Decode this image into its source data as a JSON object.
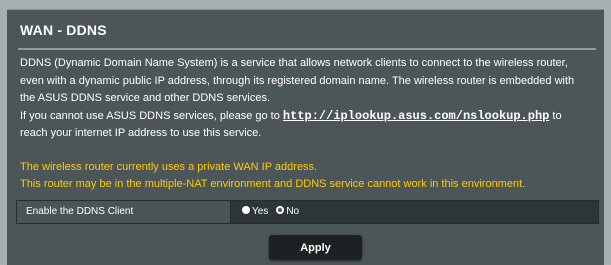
{
  "title": "WAN - DDNS",
  "description": {
    "paragraph1": "DDNS (Dynamic Domain Name System) is a service that allows network clients to connect to the wireless router, even with a dynamic public IP address, through its registered domain name. The wireless router is embedded with the ASUS DDNS service and other DDNS services.",
    "paragraph2_before": "If you cannot use ASUS DDNS services, please go to ",
    "link": "http://iplookup.asus.com/nslookup.php",
    "paragraph2_after": " to reach your internet IP address to use this service."
  },
  "warnings": [
    "The wireless router currently uses a private WAN IP address.",
    "This router may be in the multiple-NAT environment and DDNS service cannot work in this environment."
  ],
  "ddns_client": {
    "label": "Enable the DDNS Client",
    "options": [
      "Yes",
      "No"
    ],
    "selected": "No"
  },
  "apply_label": "Apply",
  "colors": {
    "panel": "#4c5558",
    "warning": "#ffcc00",
    "button": "#1d2123"
  }
}
